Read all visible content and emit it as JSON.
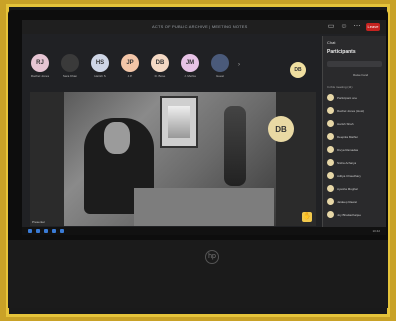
{
  "window": {
    "title": "ACTS OF PUBLIC ARCHIVE | MEETING NOTES",
    "leave_label": "Leave"
  },
  "participants_strip": [
    {
      "initials": "RJ",
      "name": "Rachel Jones",
      "color": "#e6c5d3"
    },
    {
      "initials": "",
      "name": "Sara Khan",
      "color": "#3a3a3a"
    },
    {
      "initials": "HS",
      "name": "Harish S",
      "color": "#cfd6e6"
    },
    {
      "initials": "JP",
      "name": "J.P.",
      "color": "#f3c6a8"
    },
    {
      "initials": "DB",
      "name": "D. Bose",
      "color": "#f4d9c4"
    },
    {
      "initials": "JM",
      "name": "J. Mehta",
      "color": "#e7c3e6"
    },
    {
      "initials": "",
      "name": "Guest",
      "color": "#4a5a7a"
    }
  ],
  "self": {
    "initials": "DB"
  },
  "main_video": {
    "presenter_initials": "DB",
    "name": "Presenter"
  },
  "panel": {
    "header": "Chat",
    "title": "Participants",
    "raise_text": "Raise hand",
    "section": "In this meeting (11)",
    "people": [
      "Participant one",
      "Rachel Jones (Host)",
      "Harish Shah",
      "Deepika Mathur",
      "Divya Ramadas",
      "Nisha Acharya",
      "Aditya Chaudhary",
      "Ayesha Mughal",
      "Jaideep Rawat",
      "Joy Bhattacharjee"
    ]
  },
  "taskbar": {
    "clock": "10:42"
  }
}
